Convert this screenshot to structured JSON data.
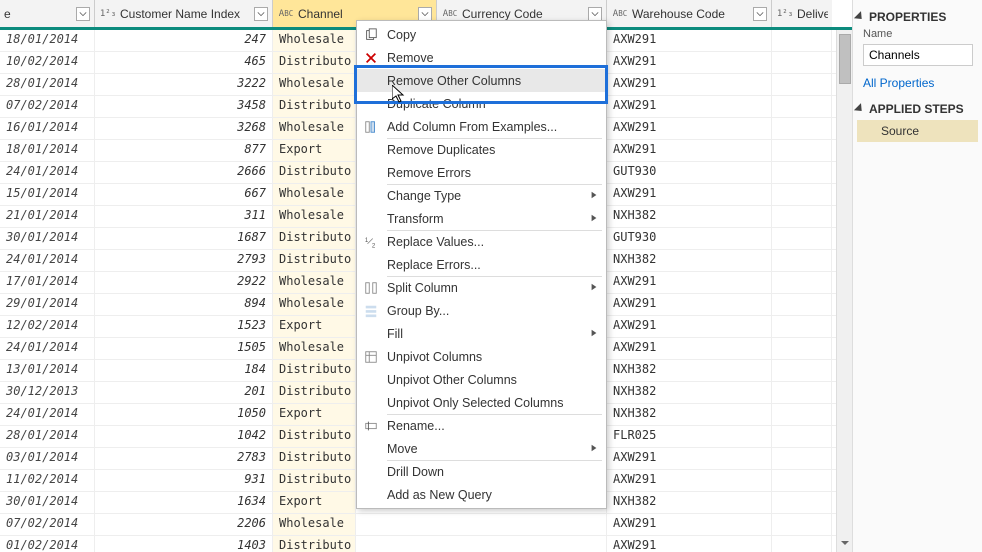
{
  "headers": {
    "date": "e",
    "customer": "Customer Name Index",
    "channel": "Channel",
    "currency": "Currency Code",
    "warehouse": "Warehouse Code",
    "delivery": "Deliver"
  },
  "rows": [
    {
      "date": "18/01/2014",
      "idx": "247",
      "chan": "Wholesale",
      "wh": "AXW291"
    },
    {
      "date": "10/02/2014",
      "idx": "465",
      "chan": "Distributo",
      "wh": "AXW291"
    },
    {
      "date": "28/01/2014",
      "idx": "3222",
      "chan": "Wholesale",
      "wh": "AXW291"
    },
    {
      "date": "07/02/2014",
      "idx": "3458",
      "chan": "Distributo",
      "wh": "AXW291"
    },
    {
      "date": "16/01/2014",
      "idx": "3268",
      "chan": "Wholesale",
      "wh": "AXW291"
    },
    {
      "date": "18/01/2014",
      "idx": "877",
      "chan": "Export",
      "wh": "AXW291"
    },
    {
      "date": "24/01/2014",
      "idx": "2666",
      "chan": "Distributo",
      "wh": "GUT930"
    },
    {
      "date": "15/01/2014",
      "idx": "667",
      "chan": "Wholesale",
      "wh": "AXW291"
    },
    {
      "date": "21/01/2014",
      "idx": "311",
      "chan": "Wholesale",
      "wh": "NXH382"
    },
    {
      "date": "30/01/2014",
      "idx": "1687",
      "chan": "Distributo",
      "wh": "GUT930"
    },
    {
      "date": "24/01/2014",
      "idx": "2793",
      "chan": "Distributo",
      "wh": "NXH382"
    },
    {
      "date": "17/01/2014",
      "idx": "2922",
      "chan": "Wholesale",
      "wh": "AXW291"
    },
    {
      "date": "29/01/2014",
      "idx": "894",
      "chan": "Wholesale",
      "wh": "AXW291"
    },
    {
      "date": "12/02/2014",
      "idx": "1523",
      "chan": "Export",
      "wh": "AXW291"
    },
    {
      "date": "24/01/2014",
      "idx": "1505",
      "chan": "Wholesale",
      "wh": "AXW291"
    },
    {
      "date": "13/01/2014",
      "idx": "184",
      "chan": "Distributo",
      "wh": "NXH382"
    },
    {
      "date": "30/12/2013",
      "idx": "201",
      "chan": "Distributo",
      "wh": "NXH382"
    },
    {
      "date": "24/01/2014",
      "idx": "1050",
      "chan": "Export",
      "wh": "NXH382"
    },
    {
      "date": "28/01/2014",
      "idx": "1042",
      "chan": "Distributo",
      "wh": "FLR025"
    },
    {
      "date": "03/01/2014",
      "idx": "2783",
      "chan": "Distributo",
      "wh": "AXW291"
    },
    {
      "date": "11/02/2014",
      "idx": "931",
      "chan": "Distributo",
      "wh": "AXW291"
    },
    {
      "date": "30/01/2014",
      "idx": "1634",
      "chan": "Export",
      "wh": "NXH382"
    },
    {
      "date": "07/02/2014",
      "idx": "2206",
      "chan": "Wholesale",
      "wh": "AXW291"
    },
    {
      "date": "01/02/2014",
      "idx": "1403",
      "chan": "Distributo",
      "wh": "AXW291"
    }
  ],
  "menu": {
    "copy": "Copy",
    "remove": "Remove",
    "removeOther": "Remove Other Columns",
    "duplicate": "Duplicate Column",
    "addFromEx": "Add Column From Examples...",
    "removeDup": "Remove Duplicates",
    "removeErr": "Remove Errors",
    "changeType": "Change Type",
    "transform": "Transform",
    "replaceVal": "Replace Values...",
    "replaceErr": "Replace Errors...",
    "splitCol": "Split Column",
    "groupBy": "Group By...",
    "fill": "Fill",
    "unpivot": "Unpivot Columns",
    "unpivotOther": "Unpivot Other Columns",
    "unpivotSel": "Unpivot Only Selected Columns",
    "rename": "Rename...",
    "move": "Move",
    "drillDown": "Drill Down",
    "addQuery": "Add as New Query"
  },
  "side": {
    "properties": "PROPERTIES",
    "nameLabel": "Name",
    "nameValue": "Channels",
    "allProps": "All Properties",
    "appliedSteps": "APPLIED STEPS",
    "source": "Source"
  }
}
